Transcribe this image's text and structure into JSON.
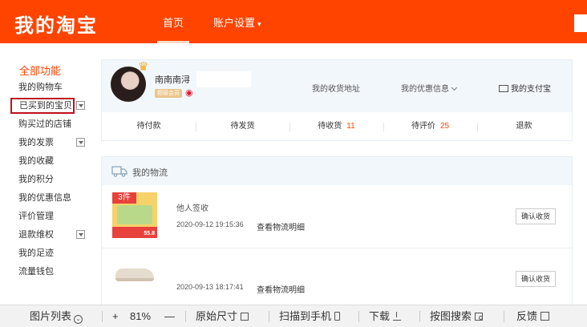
{
  "header": {
    "logo": "我的淘宝",
    "nav": {
      "home": "首页",
      "settings": "账户设置"
    }
  },
  "sidebar": {
    "all_functions": "全部功能",
    "items": [
      {
        "label": "我的购物车"
      },
      {
        "label": "已买到的宝贝"
      },
      {
        "label": "购买过的店铺"
      },
      {
        "label": "我的发票"
      },
      {
        "label": "我的收藏"
      },
      {
        "label": "我的积分"
      },
      {
        "label": "我的优惠信息"
      },
      {
        "label": "评价管理"
      },
      {
        "label": "退款维权"
      },
      {
        "label": "我的足迹"
      },
      {
        "label": "流量钱包"
      }
    ]
  },
  "profile": {
    "username": "南南南浔",
    "member_badge": "超级会员",
    "links": {
      "address": "我的收货地址",
      "coupons": "我的优惠信息",
      "alipay": "我的支付宝"
    },
    "orders": [
      {
        "label": "待付款",
        "count": ""
      },
      {
        "label": "待发货",
        "count": ""
      },
      {
        "label": "待收货",
        "count": "11"
      },
      {
        "label": "待评价",
        "count": "25"
      },
      {
        "label": "退款",
        "count": ""
      }
    ]
  },
  "logistics": {
    "title": "我的物流",
    "items": [
      {
        "tag": "3件",
        "price": "55.8",
        "status": "他人签收",
        "time": "2020-09-12 19:15:36",
        "detail": "查看物流明细",
        "button": "确认收货"
      },
      {
        "status": "",
        "time": "2020-09-13 18:17:41",
        "detail": "查看物流明细",
        "button": "确认收货"
      }
    ]
  },
  "toolbar": {
    "image_list": "图片列表",
    "zoom_in": "+",
    "zoom": "81%",
    "zoom_out": "—",
    "original_size": "原始尺寸",
    "scan_to_phone": "扫描到手机",
    "download": "下载",
    "search_by_image": "按图搜索",
    "feedback": "反馈"
  },
  "colors": {
    "brand": "#ff4400",
    "accent_text": "#ff4400",
    "selection_outline": "#c0101a"
  }
}
